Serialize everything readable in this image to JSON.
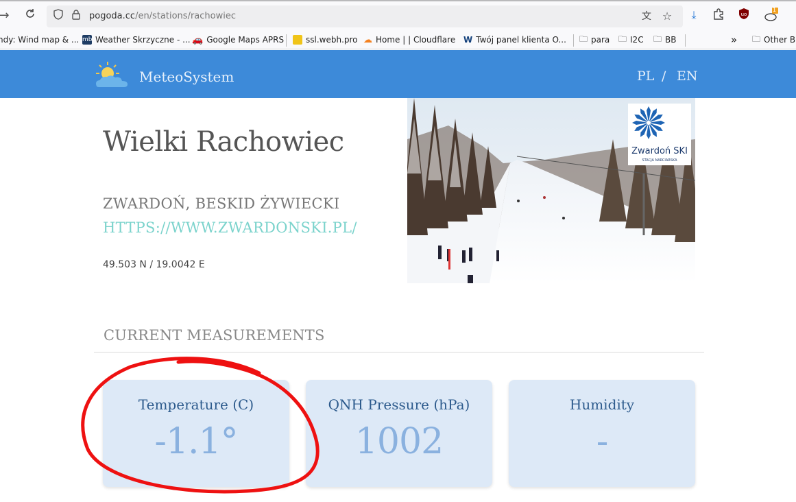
{
  "browser": {
    "url_host": "pogoda.cc",
    "url_path": "/en/stations/rachowiec",
    "bookmarks": [
      {
        "label": "ndy: Wind map & ..."
      },
      {
        "label": "Weather Skrzyczne - ..."
      },
      {
        "label": "Google Maps APRS"
      },
      {
        "label": "ssl.webh.pro"
      },
      {
        "label": "Home | | Cloudflare"
      },
      {
        "label": "Twój panel klienta O..."
      },
      {
        "label": "para"
      },
      {
        "label": "I2C"
      },
      {
        "label": "BB"
      },
      {
        "label": "Other B"
      }
    ],
    "notification_count": "1"
  },
  "header": {
    "brand": "MeteoSystem",
    "lang_pl": "PL",
    "lang_sep": "/",
    "lang_en": "EN"
  },
  "station": {
    "name": "Wielki Rachowiec",
    "region": "ZWARDOŃ, BESKID ŻYWIECKI",
    "link": "HTTPS://WWW.ZWARDONSKI.PL/",
    "coords": "49.503 N / 19.0042 E",
    "photo_logo_text": "Zwardoń SKI",
    "photo_logo_sub": "STACJA NARCIARSKA"
  },
  "measurements": {
    "title": "CURRENT MEASUREMENTS",
    "cards": [
      {
        "label": "Temperature (C)",
        "value": "-1.1°"
      },
      {
        "label": "QNH Pressure (hPa)",
        "value": "1002"
      },
      {
        "label": "Humidity",
        "value": "-"
      }
    ]
  },
  "colors": {
    "header_bg": "#3d8ad9",
    "card_bg": "#dde9f7",
    "card_value": "#8ab1df",
    "link": "#7bd3cc",
    "annotation": "#ee1111"
  }
}
